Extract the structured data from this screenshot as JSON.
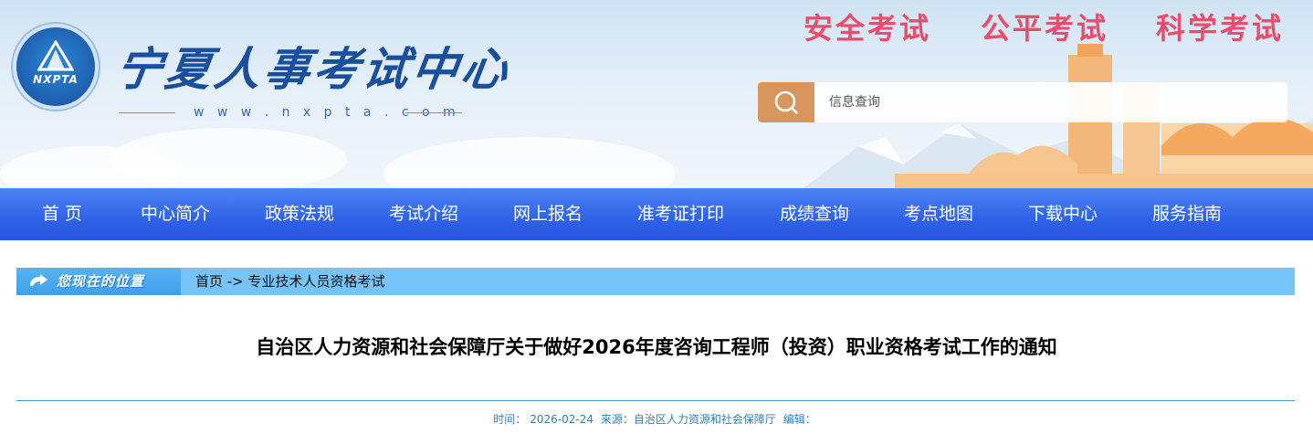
{
  "header": {
    "logo_text": "NXPTA",
    "site_title": "宁夏人事考试中心",
    "site_url": "w w w . n x p t a . c o m",
    "slogans": [
      "安全考试",
      "公平考试",
      "科学考试"
    ],
    "search": {
      "placeholder": "信息查询",
      "icon": "search-icon"
    }
  },
  "nav": {
    "items": [
      "首 页",
      "中心简介",
      "政策法规",
      "考试介绍",
      "网上报名",
      "准考证打印",
      "成绩查询",
      "考点地图",
      "下载中心",
      "服务指南"
    ]
  },
  "breadcrumb": {
    "label": "您现在的位置",
    "path": "首页 -> 专业技术人员资格考试"
  },
  "article": {
    "title": "自治区人力资源和社会保障厅关于做好2026年度咨询工程师（投资）职业资格考试工作的通知",
    "meta": {
      "time_label": "时间：",
      "time": "2026-02-24",
      "source_label": "来源：",
      "source": "自治区人力资源和社会保障厅",
      "editor_label": "编辑："
    }
  },
  "colors": {
    "nav_bg": "#3366ee",
    "slogan": "#e84d6b",
    "title_blue": "#1a4f9c",
    "search_btn": "#d9965c",
    "crumb_bg": "#75c3f7"
  }
}
